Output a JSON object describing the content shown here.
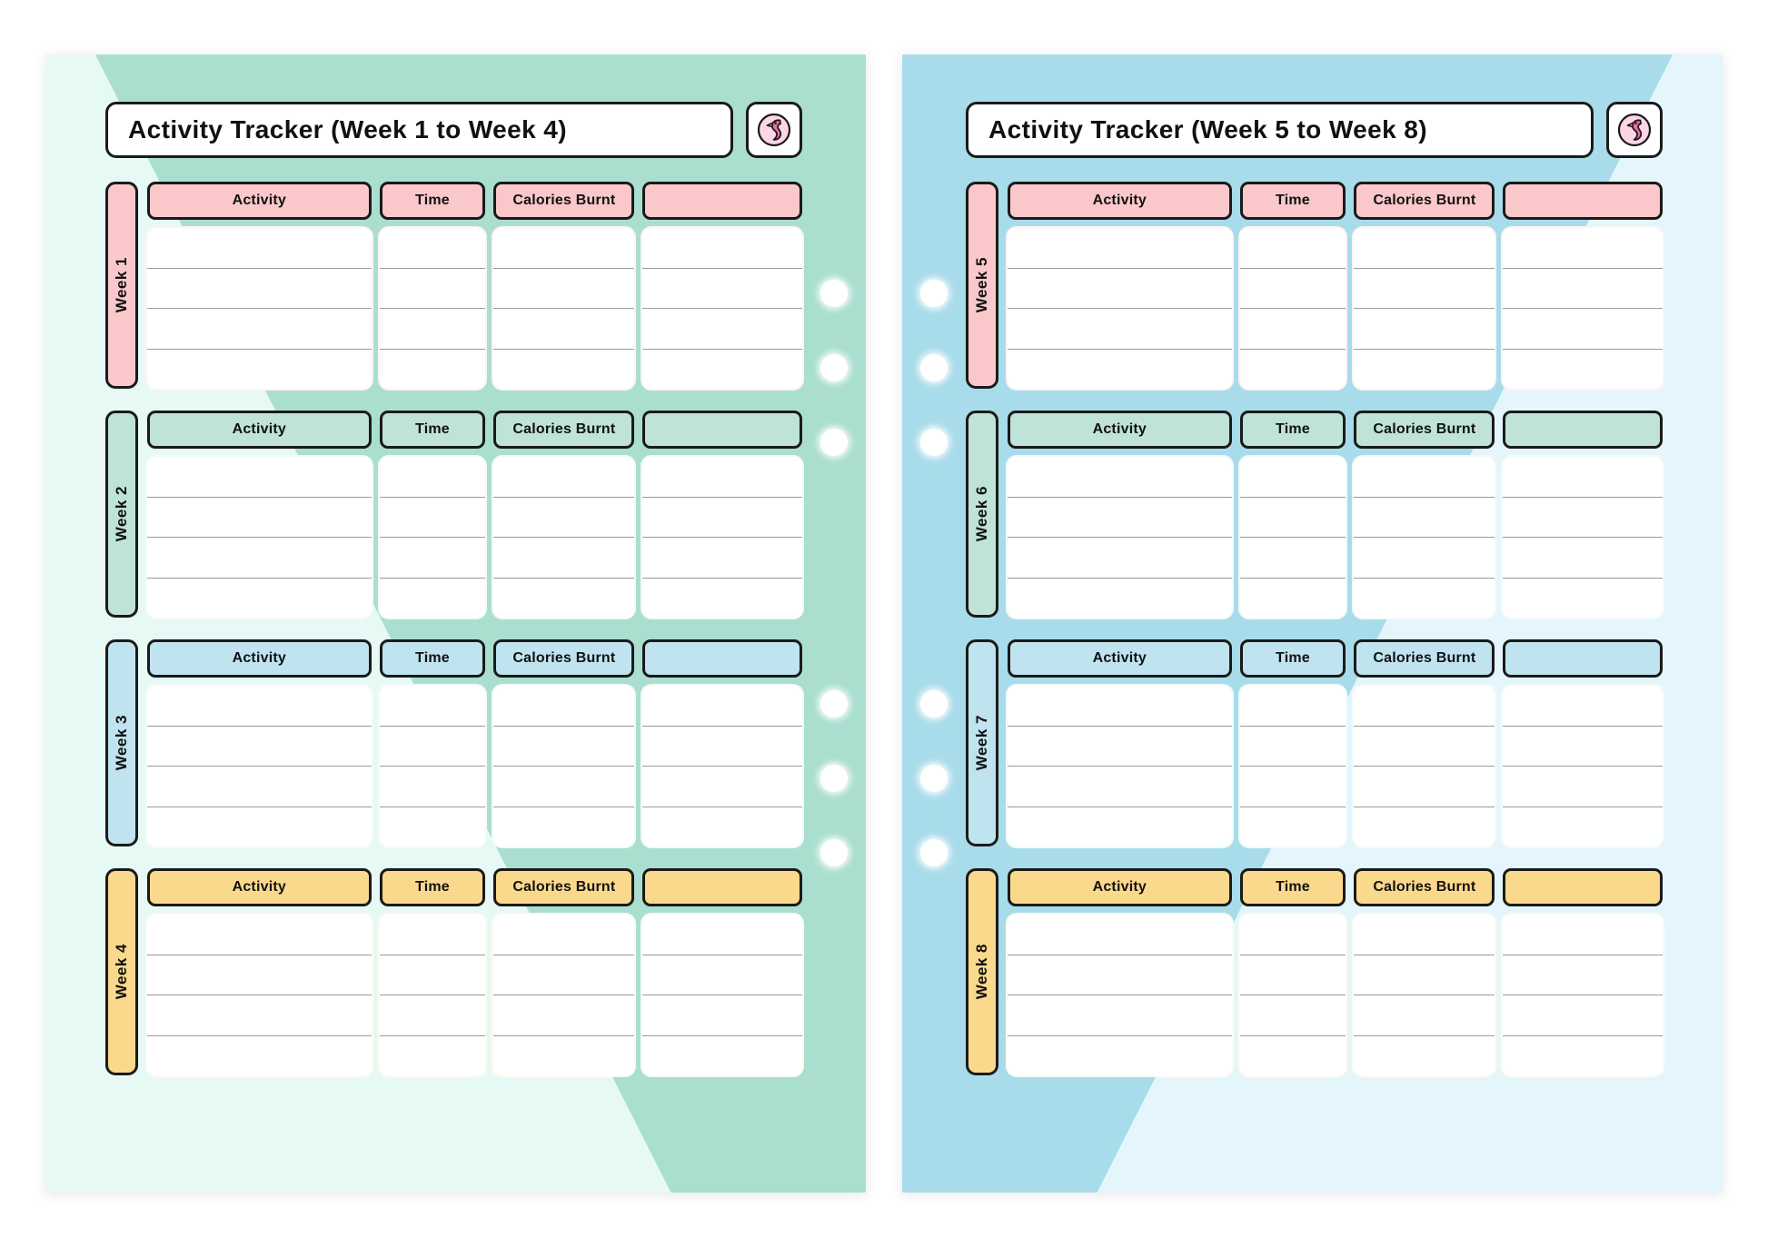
{
  "document": {
    "kind": "printable-planner-spread",
    "page_count": 2
  },
  "columns": {
    "activity": "Activity",
    "time": "Time",
    "calories": "Calories Burnt",
    "extra": ""
  },
  "logo": {
    "icon": "flamingo-icon",
    "body_color": "#f06ba8",
    "disc_color": "#fbd7e6",
    "beak_color": "#efe2c4"
  },
  "palette": {
    "page_left_bg": "#e7f9f4",
    "page_left_accent": "#aadfd0",
    "page_right_bg": "#e4f6fb",
    "page_right_accent": "#a9dcea",
    "outline": "#1a1a1a",
    "row_rule": "#9b9b9b",
    "pink": "#fac8cb",
    "mint": "#bfe3d8",
    "blue": "#bfe4ef",
    "yellow": "#fbd98c",
    "hole": "#ffffff"
  },
  "rows_per_week": 4,
  "pages": [
    {
      "id": "page-left",
      "title": "Activity Tracker (Week 1 to Week 4)",
      "bg": "#e7f9f4",
      "accent": "#aadfd0",
      "holes_side": "right",
      "hole_positions": [
        248,
        330,
        412,
        700,
        782,
        864
      ],
      "sections": [
        {
          "week_label": "Week 1",
          "color": "#fac8cb",
          "body_tint": "#fdf4f4"
        },
        {
          "week_label": "Week 2",
          "color": "#bfe3d8",
          "body_tint": "#f2fbf8"
        },
        {
          "week_label": "Week 3",
          "color": "#bfe4ef",
          "body_tint": "#f2fbfd"
        },
        {
          "week_label": "Week 4",
          "color": "#fbd98c",
          "body_tint": "#fefcf0"
        }
      ]
    },
    {
      "id": "page-right",
      "title": "Activity Tracker (Week 5 to Week 8)",
      "bg": "#e4f6fb",
      "accent": "#a9dcea",
      "holes_side": "left",
      "hole_positions": [
        248,
        330,
        412,
        700,
        782,
        864
      ],
      "sections": [
        {
          "week_label": "Week 5",
          "color": "#fac8cb",
          "body_tint": "#fdf4f4"
        },
        {
          "week_label": "Week 6",
          "color": "#bfe3d8",
          "body_tint": "#f2fbf8"
        },
        {
          "week_label": "Week 7",
          "color": "#bfe4ef",
          "body_tint": "#f2fbfd"
        },
        {
          "week_label": "Week 8",
          "color": "#fbd98c",
          "body_tint": "#fefcf0"
        }
      ]
    }
  ]
}
